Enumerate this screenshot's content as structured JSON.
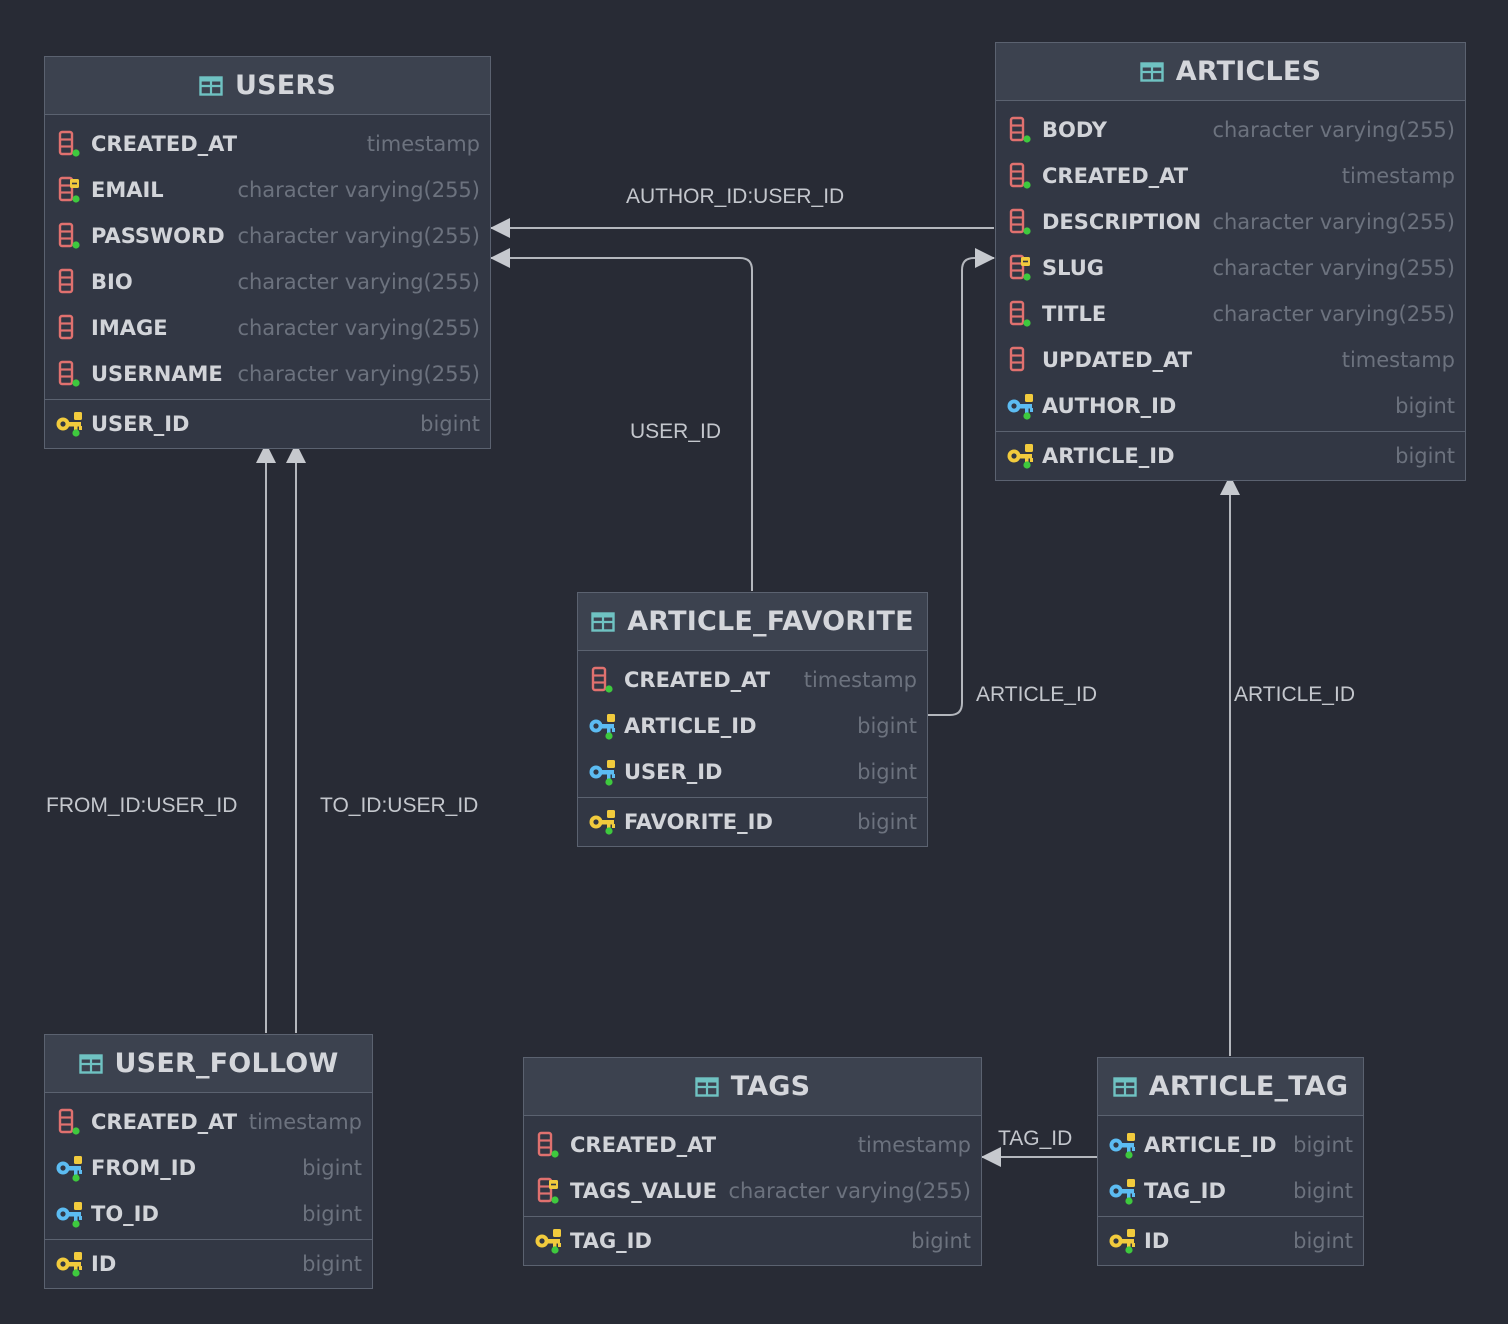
{
  "tables": {
    "users": {
      "title": "USERS",
      "columns": [
        {
          "name": "CREATED_AT",
          "type": "timestamp",
          "icon": "column-icon"
        },
        {
          "name": "EMAIL",
          "type": "character varying(255)",
          "icon": "unique-column-icon"
        },
        {
          "name": "PASSWORD",
          "type": "character varying(255)",
          "icon": "column-icon"
        },
        {
          "name": "BIO",
          "type": "character varying(255)",
          "icon": "nullable-column-icon"
        },
        {
          "name": "IMAGE",
          "type": "character varying(255)",
          "icon": "nullable-column-icon"
        },
        {
          "name": "USERNAME",
          "type": "character varying(255)",
          "icon": "column-icon"
        }
      ],
      "pk": {
        "name": "USER_ID",
        "type": "bigint",
        "icon": "primary-key-icon"
      }
    },
    "articles": {
      "title": "ARTICLES",
      "columns": [
        {
          "name": "BODY",
          "type": "character varying(255)",
          "icon": "column-icon"
        },
        {
          "name": "CREATED_AT",
          "type": "timestamp",
          "icon": "column-icon"
        },
        {
          "name": "DESCRIPTION",
          "type": "character varying(255)",
          "icon": "column-icon"
        },
        {
          "name": "SLUG",
          "type": "character varying(255)",
          "icon": "unique-column-icon"
        },
        {
          "name": "TITLE",
          "type": "character varying(255)",
          "icon": "column-icon"
        },
        {
          "name": "UPDATED_AT",
          "type": "timestamp",
          "icon": "nullable-column-icon"
        },
        {
          "name": "AUTHOR_ID",
          "type": "bigint",
          "icon": "foreign-key-icon"
        }
      ],
      "pk": {
        "name": "ARTICLE_ID",
        "type": "bigint",
        "icon": "primary-key-icon"
      }
    },
    "article_favorite": {
      "title": "ARTICLE_FAVORITE",
      "columns": [
        {
          "name": "CREATED_AT",
          "type": "timestamp",
          "icon": "column-icon"
        },
        {
          "name": "ARTICLE_ID",
          "type": "bigint",
          "icon": "foreign-key-icon"
        },
        {
          "name": "USER_ID",
          "type": "bigint",
          "icon": "foreign-key-icon"
        }
      ],
      "pk": {
        "name": "FAVORITE_ID",
        "type": "bigint",
        "icon": "primary-key-icon"
      }
    },
    "user_follow": {
      "title": "USER_FOLLOW",
      "columns": [
        {
          "name": "CREATED_AT",
          "type": "timestamp",
          "icon": "column-icon"
        },
        {
          "name": "FROM_ID",
          "type": "bigint",
          "icon": "foreign-key-icon"
        },
        {
          "name": "TO_ID",
          "type": "bigint",
          "icon": "foreign-key-icon"
        }
      ],
      "pk": {
        "name": "ID",
        "type": "bigint",
        "icon": "primary-key-icon"
      }
    },
    "tags": {
      "title": "TAGS",
      "columns": [
        {
          "name": "CREATED_AT",
          "type": "timestamp",
          "icon": "column-icon"
        },
        {
          "name": "TAGS_VALUE",
          "type": "character varying(255)",
          "icon": "unique-column-icon"
        }
      ],
      "pk": {
        "name": "TAG_ID",
        "type": "bigint",
        "icon": "primary-key-icon"
      }
    },
    "article_tag": {
      "title": "ARTICLE_TAG",
      "columns": [
        {
          "name": "ARTICLE_ID",
          "type": "bigint",
          "icon": "foreign-key-icon"
        },
        {
          "name": "TAG_ID",
          "type": "bigint",
          "icon": "foreign-key-icon"
        }
      ],
      "pk": {
        "name": "ID",
        "type": "bigint",
        "icon": "primary-key-icon"
      }
    }
  },
  "relations": {
    "author": "AUTHOR_ID:USER_ID",
    "favorite_user": "USER_ID",
    "favorite_article": "ARTICLE_ID",
    "tag_article": "ARTICLE_ID",
    "follow_from": "FROM_ID:USER_ID",
    "follow_to": "TO_ID:USER_ID",
    "tag_tag": "TAG_ID"
  },
  "colors": {
    "background": "#282b35",
    "table_body": "#323744",
    "table_header": "#3c424f",
    "border": "#5b6270",
    "line": "#b4b7bd",
    "column_icon": "#e0716f",
    "primary_key": "#f2cb3d",
    "foreign_key": "#5cbcf2",
    "not_null_dot": "#3ec93e",
    "table_icon": "#6fc2c2"
  }
}
